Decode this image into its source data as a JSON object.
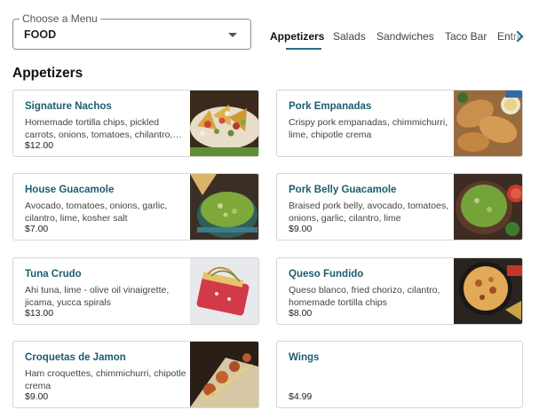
{
  "menu_select": {
    "legend": "Choose a Menu",
    "value": "FOOD"
  },
  "tabs": [
    {
      "label": "Appetizers",
      "active": true
    },
    {
      "label": "Salads",
      "active": false
    },
    {
      "label": "Sandwiches",
      "active": false
    },
    {
      "label": "Taco Bar",
      "active": false
    },
    {
      "label": "Entrees",
      "active": false
    }
  ],
  "section": {
    "title": "Appetizers"
  },
  "items": [
    {
      "name": "Signature Nachos",
      "description": "Homemade tortilla chips, pickled carrots, onions, tomatoes, chilantro, lime",
      "price": "$12.00"
    },
    {
      "name": "Pork Empanadas",
      "description": "Crispy pork empanadas, chimmichurri, lime, chipotle crema",
      "price": ""
    },
    {
      "name": "House Guacamole",
      "description": "Avocado, tomatoes, onions, garlic, cilantro, lime, kosher salt",
      "price": "$7.00"
    },
    {
      "name": "Pork Belly Guacamole",
      "description": "Braised pork belly, avocado, tomatoes, onions, garlic, cilantro, lime",
      "price": "$9.00"
    },
    {
      "name": "Tuna Crudo",
      "description": "Ahi tuna, lime - olive oil vinaigrette, jicama, yucca spirals",
      "price": "$13.00"
    },
    {
      "name": "Queso Fundido",
      "description": "Queso blanco, fried chorizo, cilantro, homemade tortilla chips",
      "price": "$8.00"
    },
    {
      "name": "Croquetas de Jamon",
      "description": "Ham croquettes, chimmichurri, chipotle crema",
      "price": "$9.00"
    },
    {
      "name": "Wings",
      "description": "",
      "price": "$4.99"
    }
  ],
  "icons": {
    "dropdown": "caret-down-icon",
    "scroll_tabs": "chevron-right-icon"
  },
  "colors": {
    "accent": "#1f6f86",
    "item_name": "#1c5d70"
  }
}
